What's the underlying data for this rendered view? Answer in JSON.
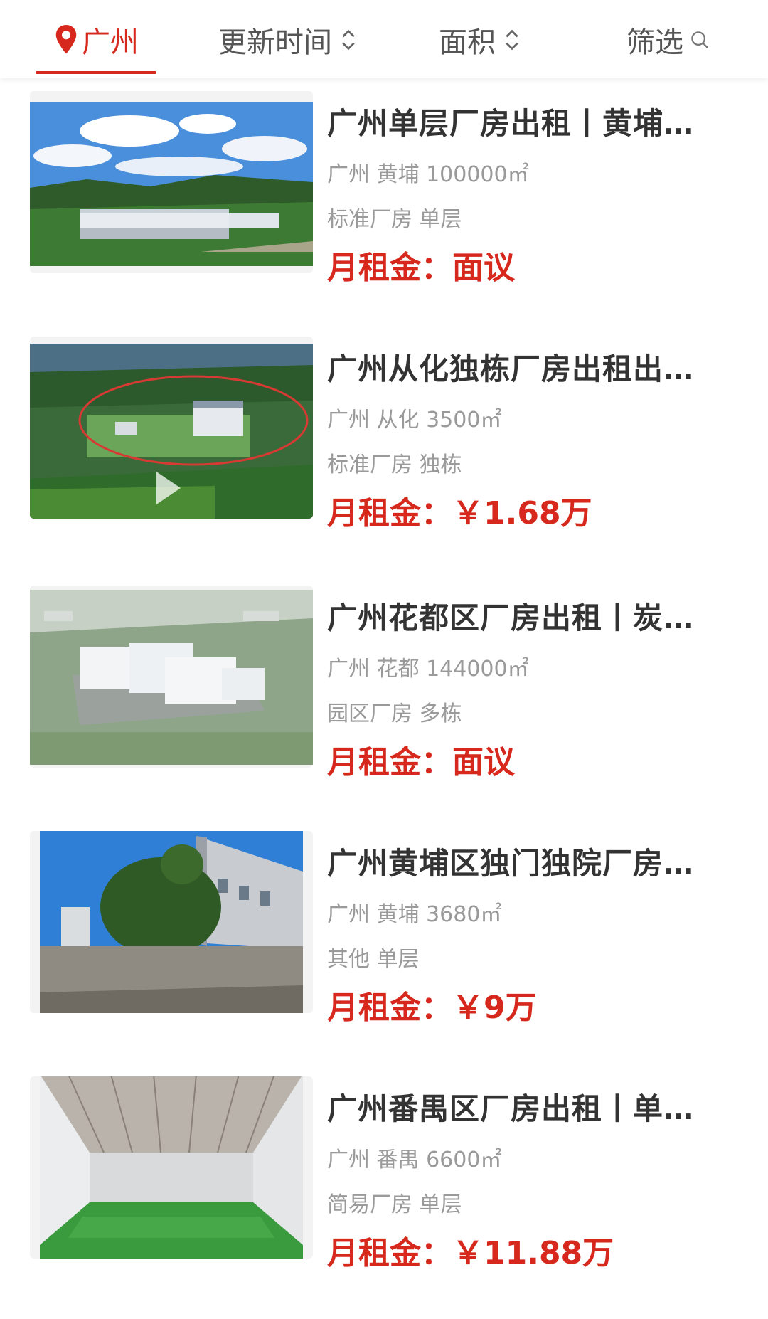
{
  "tabs": {
    "city": "广州",
    "time": "更新时间",
    "area": "面积",
    "filter": "筛选"
  },
  "colors": {
    "accent": "#d6281d",
    "title": "#333333",
    "meta": "#9a9a9a"
  },
  "listings": [
    {
      "title": "广州单层厂房出租丨黄埔…",
      "location": "广州 黄埔 100000㎡",
      "type": "标准厂房 单层",
      "price_label": "月租金：",
      "price_value": "面议",
      "image_icon": "factory-aerial-image"
    },
    {
      "title": "广州从化独栋厂房出租出…",
      "location": "广州 从化 3500㎡",
      "type": "标准厂房 独栋",
      "price_label": "月租金：",
      "price_value": "￥1.68万",
      "image_icon": "factory-video-thumbnail"
    },
    {
      "title": "广州花都区厂房出租丨炭…",
      "location": "广州 花都 144000㎡",
      "type": "园区厂房 多栋",
      "price_label": "月租金：",
      "price_value": "面议",
      "image_icon": "industrial-park-render"
    },
    {
      "title": "广州黄埔区独门独院厂房…",
      "location": "广州 黄埔 3680㎡",
      "type": "其他 单层",
      "price_label": "月租金：",
      "price_value": "￥9万",
      "image_icon": "factory-building-photo"
    },
    {
      "title": "广州番禺区厂房出租丨单…",
      "location": "广州 番禺 6600㎡",
      "type": "简易厂房 单层",
      "price_label": "月租金：",
      "price_value": "￥11.88万",
      "image_icon": "factory-interior-photo"
    }
  ]
}
